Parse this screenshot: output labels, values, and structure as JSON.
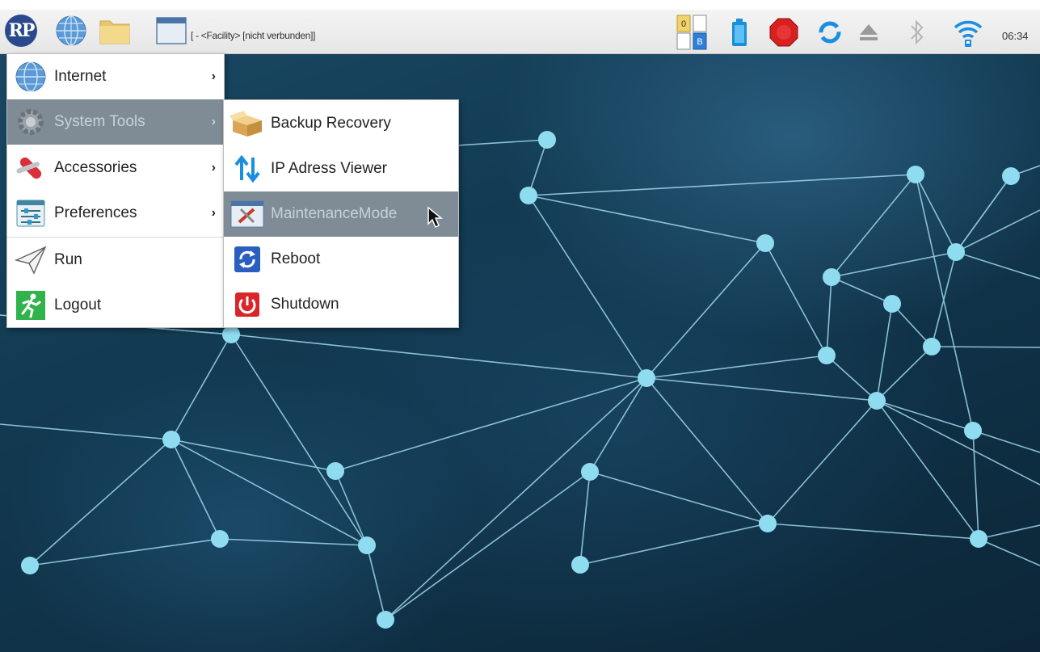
{
  "taskbar": {
    "logo_text": "RP",
    "window_title": "[ - <Facility> [nicht verbunden]]",
    "clock": "06:34",
    "tray_icons": [
      "keyboard-indicator-icon",
      "battery-icon",
      "stop-icon",
      "sync-icon",
      "eject-icon",
      "bluetooth-icon",
      "wifi-icon"
    ]
  },
  "main_menu": {
    "items": [
      {
        "label": "Internet",
        "icon": "globe-icon",
        "submenu": true
      },
      {
        "label": "System Tools",
        "icon": "gear-icon",
        "submenu": true,
        "highlighted": true
      },
      {
        "label": "Accessories",
        "icon": "swiss-knife-icon",
        "submenu": true
      },
      {
        "label": "Preferences",
        "icon": "sliders-icon",
        "submenu": true
      },
      {
        "label": "Run",
        "icon": "paper-plane-icon",
        "submenu": false
      },
      {
        "label": "Logout",
        "icon": "running-man-icon",
        "submenu": false
      }
    ],
    "arrow": "›"
  },
  "sub_menu": {
    "items": [
      {
        "label": "Backup Recovery",
        "icon": "box-icon"
      },
      {
        "label": "IP Adress Viewer",
        "icon": "up-down-arrows-icon"
      },
      {
        "label": "MaintenanceMode",
        "icon": "tools-icon",
        "highlighted": true
      },
      {
        "label": "Reboot",
        "icon": "reboot-icon"
      },
      {
        "label": "Shutdown",
        "icon": "power-icon"
      }
    ]
  },
  "tray": {
    "keyboard_top": "0",
    "keyboard_bottom": "B"
  },
  "colors": {
    "menu_highlight": "#7f8c96",
    "node": "#8fdcf0",
    "link": "#9fd8ec"
  }
}
